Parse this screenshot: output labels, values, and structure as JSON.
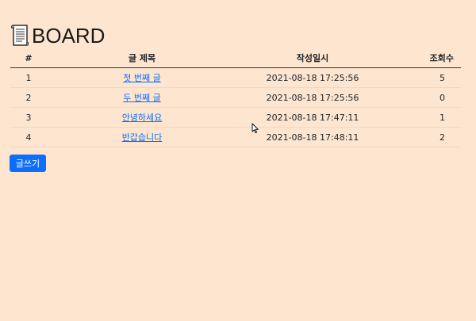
{
  "header": {
    "title": "BOARD",
    "icon": "scroll-icon"
  },
  "table": {
    "columns": [
      "#",
      "글 제목",
      "작성일시",
      "조회수"
    ],
    "rows": [
      {
        "num": "1",
        "title": "첫 번째 글",
        "date": "2021-08-18 17:25:56",
        "views": "5"
      },
      {
        "num": "2",
        "title": "두 번째 글",
        "date": "2021-08-18 17:25:56",
        "views": "0"
      },
      {
        "num": "3",
        "title": "안녕하세요",
        "date": "2021-08-18 17:47:11",
        "views": "1"
      },
      {
        "num": "4",
        "title": "반갑습니다",
        "date": "2021-08-18 17:48:11",
        "views": "2"
      }
    ]
  },
  "actions": {
    "write_label": "글쓰기"
  },
  "colors": {
    "background": "#fde5cf",
    "link": "#0d6efd",
    "button": "#0d6efd"
  }
}
